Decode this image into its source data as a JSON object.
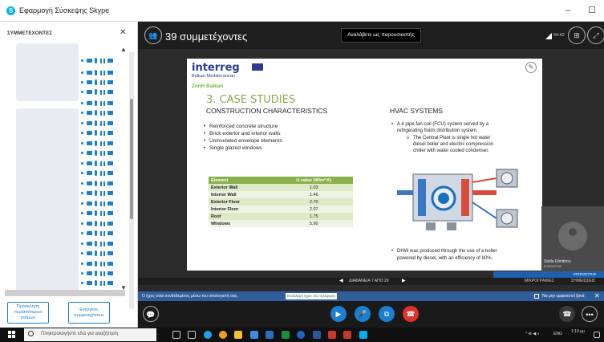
{
  "window": {
    "title": "Εφαρμογή Σύσκεψης Skype",
    "app_icon": "skype-logo-icon"
  },
  "left_panel": {
    "header": "ΣΥΜΜΕΤΕΧΟΝΤΕΣ",
    "footer_buttons": [
      {
        "label": "Πρόσκληση περισσότερων ατόμων"
      },
      {
        "label": "Ενέργειες συμμετεχόντων"
      }
    ]
  },
  "call": {
    "participant_count": "39 συμμετέχοντες",
    "share_button": "Αναλάβετε ως παρουσιαστής",
    "clock": "54:42"
  },
  "slide": {
    "logo_word": "interreg",
    "logo_sub1": "Balkan-Mediterranean",
    "logo_sub2": "ZenH Balkan",
    "title": "3. CASE STUDIES",
    "construction_heading": "CONSTRUCTION CHARACTERISTICS",
    "construction_bullets": [
      "Reinforced concrete structure",
      "Brick exterior and interior walls",
      "Uninsulated envelope elements",
      "Single glazed windows"
    ],
    "table": {
      "headers": [
        "Element",
        "U value (W/m² K)"
      ],
      "rows": [
        [
          "Exterior Wall",
          "1.03"
        ],
        [
          "Interior Wall",
          "1.46"
        ],
        [
          "Exterior Floor",
          "2.70"
        ],
        [
          "Interior Floor",
          "2.07"
        ],
        [
          "Roof",
          "1.75"
        ],
        [
          "Windows",
          "5.90"
        ]
      ]
    },
    "hvac_heading": "HVAC SYSTEMS",
    "hvac_bullet1a": "A 4 pipe fan-coil (FCU) system served by a",
    "hvac_bullet1b": "refrigerating fluids distribution system.",
    "hvac_sub_a": "The Central Plant is single hot water",
    "hvac_sub_b": "diesel boiler and electric compression",
    "hvac_sub_c": "chiller with water cooled condenser.",
    "hvac_bullet2a": "DHW was produced through the use of a boiler",
    "hvac_bullet2b": "powered by diesel, with an efficiency of 80%."
  },
  "slide_nav": {
    "label": "ΔΙΑΦΑΝΕΙΑ 7 ΑΠΟ 29",
    "thumbnails": "ΜΙΚΡΟΓΡΑΦΙΕΣ",
    "notes": "ΣΗΜΕΙΩΣΕΙΣ"
  },
  "presenter": {
    "name": "Stella Dimitriou",
    "subtitle": "ΕΠΙΣΚΕΠΤΗΣ",
    "bar_left": "ΕΠΙΣΚΕΠΤΗΣ",
    "bar_right": "Stella Di..."
  },
  "notification": {
    "message": "Ο ήχος είναι συνδεδεμένος μέσω του υπολογιστή σας.",
    "button": "Εναλλαγή ήχου στο τηλέφωνο",
    "checkbox_label": "Να μην εμφανιστεί ξανά"
  },
  "taskbar": {
    "search_placeholder": "Πληκτρολογήστε εδώ για αναζήτηση",
    "time": "1:19 μμ",
    "lang": "ENG"
  },
  "colors": {
    "accent_blue": "#1a7fd0",
    "slide_green": "#8bb04b",
    "end_call_red": "#e0322b"
  }
}
